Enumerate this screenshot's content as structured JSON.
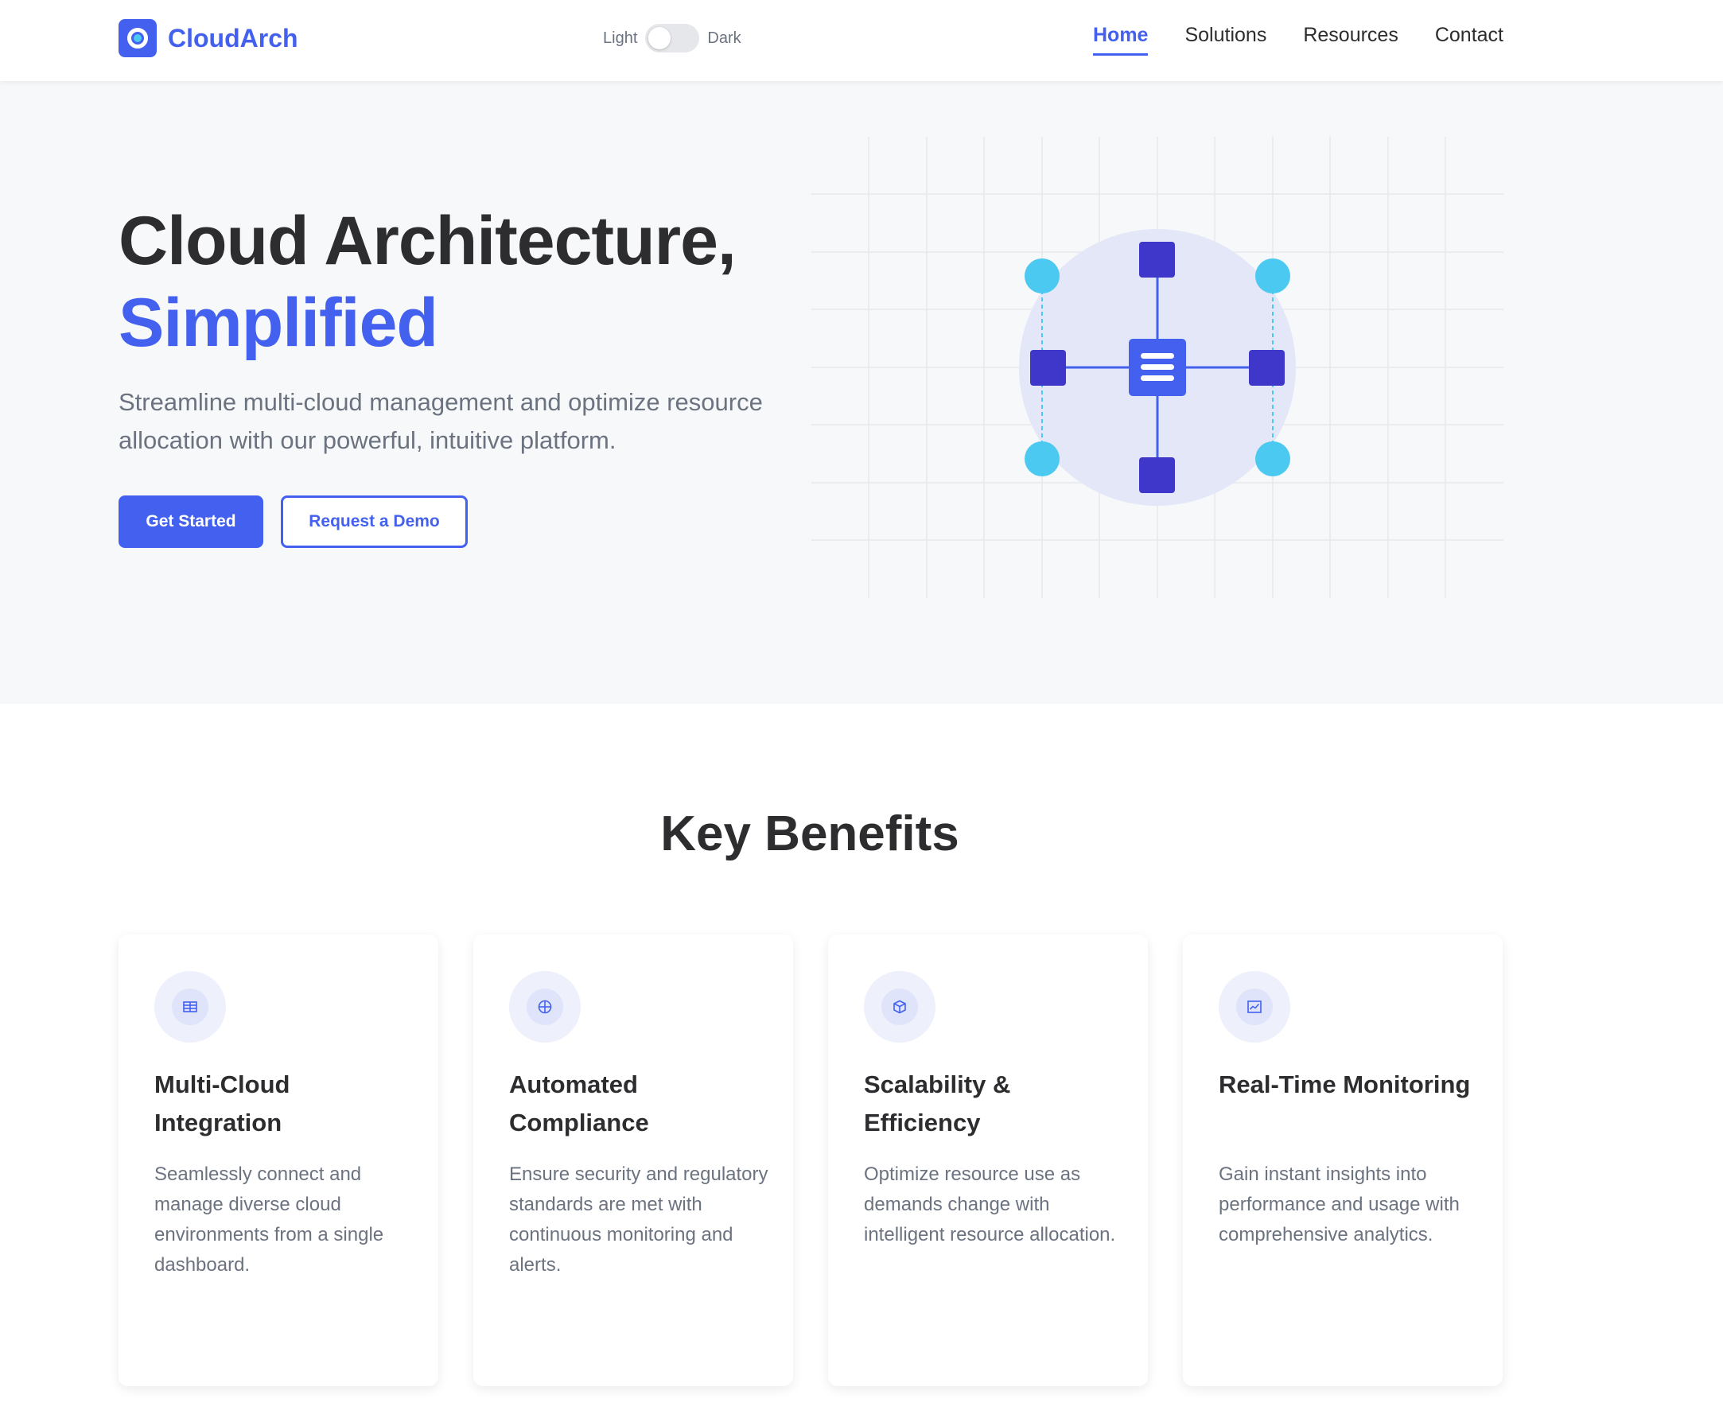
{
  "header": {
    "logo_text": "CloudArch",
    "theme_light_label": "Light",
    "theme_dark_label": "Dark",
    "nav": [
      {
        "label": "Home",
        "active": true
      },
      {
        "label": "Solutions",
        "active": false
      },
      {
        "label": "Resources",
        "active": false
      },
      {
        "label": "Contact",
        "active": false
      }
    ]
  },
  "hero": {
    "title_line1": "Cloud Architecture,",
    "title_line2": "Simplified",
    "subtitle": "Streamline multi-cloud management and optimize resource allocation with our powerful, intuitive platform.",
    "primary_button": "Get Started",
    "secondary_button": "Request a Demo"
  },
  "benefits": {
    "title": "Key Benefits",
    "cards": [
      {
        "icon": "grid-icon",
        "title": "Multi-Cloud Integration",
        "text": "Seamlessly connect and manage diverse cloud environments from a single dashboard."
      },
      {
        "icon": "globe-icon",
        "title": "Automated Compliance",
        "text": "Ensure security and regulatory standards are met with continuous monitoring and alerts."
      },
      {
        "icon": "cube-icon",
        "title": "Scalability & Efficiency",
        "text": "Optimize resource use as demands change with intelligent resource allocation."
      },
      {
        "icon": "chart-icon",
        "title": "Real-Time Monitoring",
        "text": "Gain instant insights into performance and usage with comprehensive analytics."
      }
    ]
  },
  "colors": {
    "brand": "#4361ee",
    "node_dark": "#3f37c9",
    "node_light": "#4cc9f0",
    "text_dark": "#2d2d30",
    "text_muted": "#6b7280"
  }
}
